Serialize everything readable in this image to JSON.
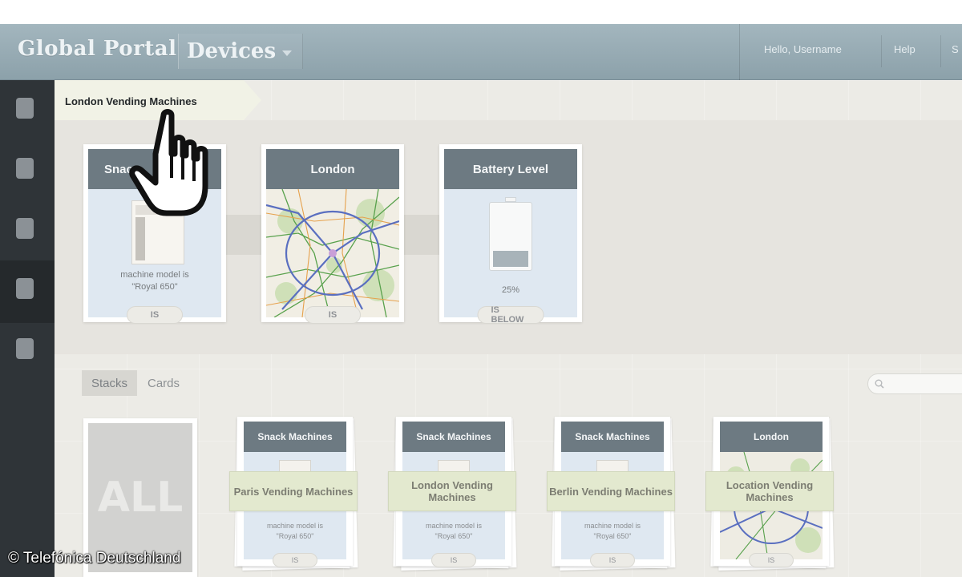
{
  "header": {
    "brand": "Global Portal",
    "section": "Devices",
    "greeting": "Hello, Username",
    "help": "Help",
    "cut_link": "S"
  },
  "sidebar": {
    "items": [
      {
        "icon": "square-icon"
      },
      {
        "icon": "square-icon"
      },
      {
        "icon": "square-icon"
      },
      {
        "icon": "square-icon",
        "active": true
      },
      {
        "icon": "square-icon"
      }
    ]
  },
  "breadcrumb": "London Vending Machines",
  "filter_cards": [
    {
      "title": "Snack Machines",
      "title_visible": "Snac",
      "desc_line1": "machine model is",
      "desc_line2": "\"Royal 650\"",
      "operator": "IS"
    },
    {
      "title": "London",
      "operator": "IS"
    },
    {
      "title": "Battery Level",
      "value": "25%",
      "level": 0.25,
      "operator": "IS BELOW"
    }
  ],
  "tabs": [
    {
      "label": "Stacks",
      "active": true
    },
    {
      "label": "Cards",
      "active": false
    }
  ],
  "search": {
    "placeholder": ""
  },
  "all_stack": {
    "label": "ALL"
  },
  "stacks": [
    {
      "header": "Snack Machines",
      "label": "Paris Vending Machines",
      "desc_line1": "machine model is",
      "desc_line2": "\"Royal 650\"",
      "pill": "IS"
    },
    {
      "header": "Snack Machines",
      "label": "London Vending Machines",
      "desc_line1": "machine model is",
      "desc_line2": "\"Royal 650\"",
      "pill": "IS"
    },
    {
      "header": "Snack Machines",
      "label": "Berlin Vending Machines",
      "desc_line1": "machine model is",
      "desc_line2": "\"Royal 650\"",
      "pill": "IS"
    },
    {
      "header": "London",
      "label": "Location Vending Machines",
      "pill": "IS"
    }
  ],
  "watermark": "© Telefónica Deutschland",
  "colors": {
    "header": "#93a7b0",
    "sidebar": "#2f3438",
    "card_header": "#6d7a82",
    "card_body": "#dfe8f1",
    "label_band": "#e3e9cf"
  }
}
